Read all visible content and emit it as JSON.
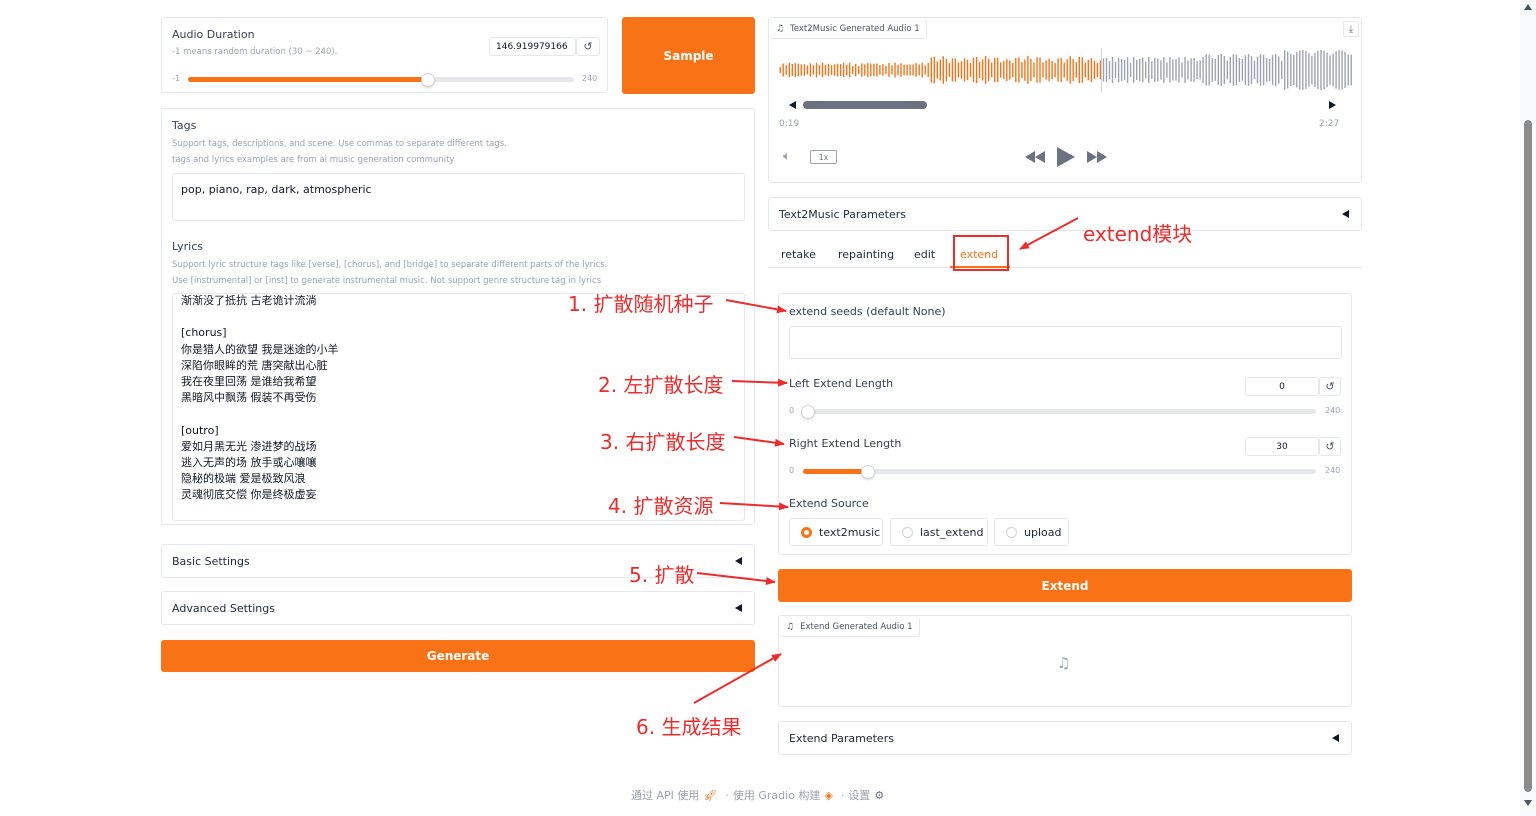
{
  "audio_duration": {
    "label": "Audio Duration",
    "hint": "-1 means random duration (30 ~ 240).",
    "value": "146.919979166",
    "min_label": "-1",
    "max_label": "240",
    "level_fraction": 0.62
  },
  "sample_button": "Sample",
  "tags": {
    "label": "Tags",
    "hint1": "Support tags, descriptions, and scene. Use commas to separate different tags.",
    "hint2": "tags and lyrics examples are from ai music generation community",
    "value": "pop, piano, rap, dark, atmospheric"
  },
  "lyrics": {
    "label": "Lyrics",
    "hint1": "Support lyric structure tags like [verse], [chorus], and [bridge] to separate different parts of the lyrics.",
    "hint2": "Use [instrumental] or [inst] to generate instrumental music. Not support genre structure tag in lyrics",
    "lines": [
      "渐渐没了抵抗 古老诡计流淌",
      "",
      "[chorus]",
      "你是猎人的欲望 我是迷途的小羊",
      "深陷你眼眸的荒 唐突献出心脏",
      "我在夜里回荡 是谁给我希望",
      "黑暗风中飘荡 假装不再受伤",
      "",
      "[outro]",
      "爱如月黑无光 渗进梦的战场",
      "逃入无声的场 放手或心嚷嚷",
      "隐秘的极端 爱是极致风浪",
      "灵魂彻底交偿 你是终极虚妄"
    ]
  },
  "basic_settings": "Basic Settings",
  "advanced_settings": "Advanced Settings",
  "generate_button": "Generate",
  "t2m_audio": {
    "tag": "Text2Music Generated Audio 1",
    "current_time": "0:19",
    "total_time": "2:27",
    "speed": "1x",
    "progress_fraction": 0.13
  },
  "t2m_params": "Text2Music Parameters",
  "tabs": [
    "retake",
    "repainting",
    "edit",
    "extend"
  ],
  "extend": {
    "seeds_label": "extend seeds (default None)",
    "seeds_value": "",
    "left_label": "Left Extend Length",
    "left_value": "0",
    "left_min": "0",
    "left_max": "240",
    "right_label": "Right Extend Length",
    "right_value": "30",
    "right_min": "0",
    "right_max": "240",
    "source_label": "Extend Source",
    "sources": [
      "text2music",
      "last_extend",
      "upload"
    ],
    "selected_source": "text2music",
    "button": "Extend",
    "audio_tag": "Extend Generated Audio 1",
    "params": "Extend Parameters"
  },
  "annotations": {
    "module": "extend模块",
    "a1": "1. 扩散随机种子",
    "a2": "2. 左扩散长度",
    "a3": "3. 右扩散长度",
    "a4": "4. 扩散资源",
    "a5": "5. 扩散",
    "a6": "6. 生成结果"
  },
  "footer": {
    "api": "通过 API 使用",
    "built": "使用 Gradio 构建",
    "settings": "设置"
  },
  "colors": {
    "accent": "#f97316",
    "annotation": "#ef2b2b",
    "waveform_played": "#f97316",
    "waveform_unplayed": "#9ca3af"
  }
}
